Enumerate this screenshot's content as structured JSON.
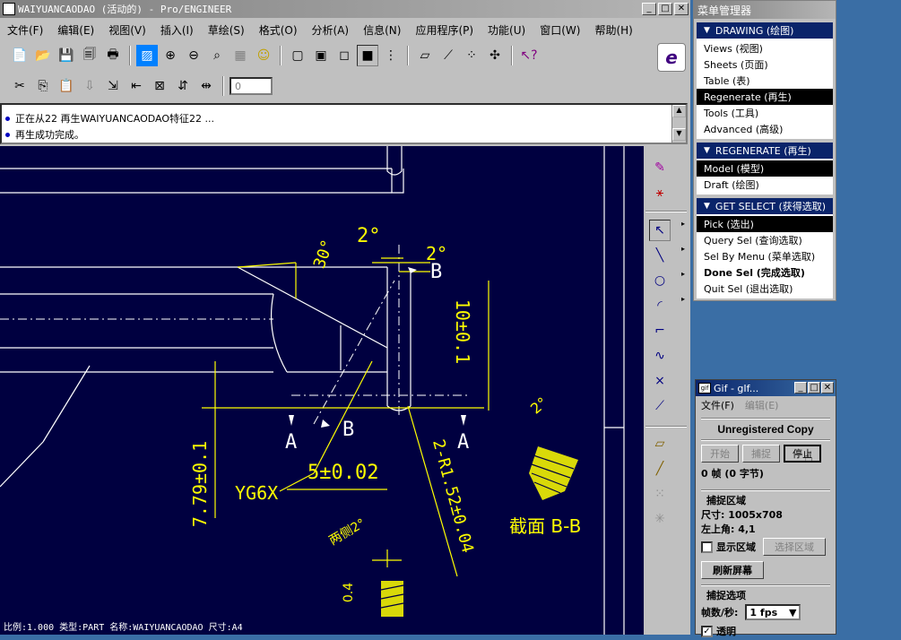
{
  "main_window": {
    "title": "WAIYUANCAODAO (活动的) - Pro/ENGINEER",
    "menu": [
      "文件(F)",
      "编辑(E)",
      "视图(V)",
      "插入(I)",
      "草绘(S)",
      "格式(O)",
      "分析(A)",
      "信息(N)",
      "应用程序(P)",
      "功能(U)",
      "窗口(W)",
      "帮助(H)"
    ],
    "spinner_value": "0",
    "messages": [
      "正在从22 再生WAIYUANCAODAO特征22 ...",
      "再生成功完成。"
    ],
    "status_bar": "比例:1.000  类型:PART  名称:WAIYUANCAODAO  尺寸:A4"
  },
  "drawing": {
    "labels": {
      "angle_2_top": "2°",
      "angle_2_right": "2°",
      "angle_30": "30°",
      "b_top": "B",
      "b_mid": "B",
      "a_left": "A",
      "a_right": "A",
      "dim_10": "10±0.1",
      "dim_779": "7.79±0.1",
      "dim_5": "5±0.02",
      "yg6x": "YG6X",
      "r152": "2-R1.52±0.04",
      "section": "截面 B-B",
      "both_sides": "两侧2°",
      "dim_04": "0.4",
      "angle_side": "2°"
    }
  },
  "menu_manager": {
    "title": "菜单管理器",
    "sections": [
      {
        "header": "DRAWING (绘图)",
        "items": [
          {
            "label": "Views (视图)",
            "selected": false,
            "bold": false
          },
          {
            "label": "Sheets (页面)",
            "selected": false,
            "bold": false
          },
          {
            "label": "Table (表)",
            "selected": false,
            "bold": false
          },
          {
            "label": "Regenerate (再生)",
            "selected": true,
            "bold": false
          },
          {
            "label": "Tools (工具)",
            "selected": false,
            "bold": false
          },
          {
            "label": "Advanced (高级)",
            "selected": false,
            "bold": false
          }
        ]
      },
      {
        "header": "REGENERATE (再生)",
        "items": [
          {
            "label": "Model (模型)",
            "selected": true,
            "bold": false
          },
          {
            "label": "Draft (绘图)",
            "selected": false,
            "bold": false
          }
        ]
      },
      {
        "header": "GET SELECT (获得选取)",
        "items": [
          {
            "label": "Pick (选出)",
            "selected": true,
            "bold": false
          },
          {
            "label": "Query Sel (查询选取)",
            "selected": false,
            "bold": false
          },
          {
            "label": "Sel By Menu (菜单选取)",
            "selected": false,
            "bold": false
          },
          {
            "label": "Done Sel (完成选取)",
            "selected": false,
            "bold": true
          },
          {
            "label": "Quit Sel (退出选取)",
            "selected": false,
            "bold": false
          }
        ]
      }
    ]
  },
  "gif_window": {
    "title": "Gif - gIf...",
    "menu_file": "文件(F)",
    "menu_edit": "编辑(E)",
    "unregistered": "Unregistered Copy",
    "btn_start": "开始",
    "btn_capture": "捕捉",
    "btn_stop": "停止",
    "frames": "0 帧 (0 字节)",
    "capture_area": "捕捉区域",
    "size": "尺寸: 1005x708",
    "topleft": "左上角: 4,1",
    "show_area": "显示区域",
    "select_area": "选择区域",
    "refresh": "刷新屏幕",
    "capture_options": "捕捉选项",
    "fps_label": "帧数/秒:",
    "fps_value": "1 fps",
    "transparent": "透明"
  }
}
